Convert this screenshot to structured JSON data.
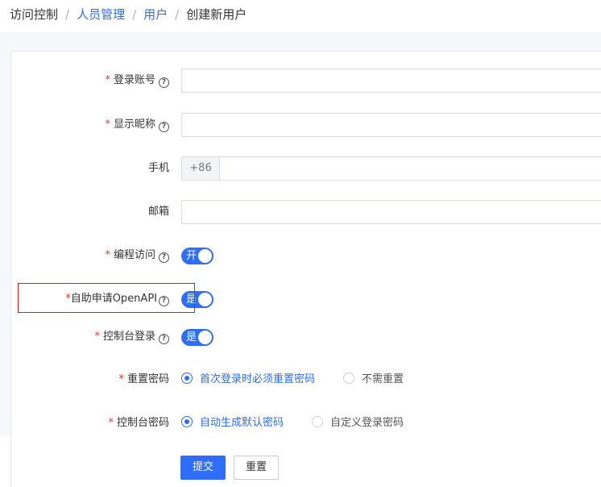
{
  "breadcrumb": {
    "items": [
      "访问控制",
      "人员管理",
      "用户",
      "创建新用户"
    ],
    "separator": "/"
  },
  "form": {
    "login_account": {
      "label": "登录账号",
      "required": "*",
      "value": ""
    },
    "display_name": {
      "label": "显示昵称",
      "required": "*",
      "value": ""
    },
    "phone": {
      "label": "手机",
      "prefix": "+86",
      "value": ""
    },
    "email": {
      "label": "邮箱",
      "value": ""
    },
    "programmatic_access": {
      "label": "编程访问",
      "required": "*",
      "switch_text": "开",
      "on": true
    },
    "self_openapi": {
      "label": "自助申请OpenAPI",
      "required": "*",
      "switch_text": "是",
      "on": true
    },
    "console_login": {
      "label": "控制台登录",
      "required": "*",
      "switch_text": "是",
      "on": true
    },
    "reset_password": {
      "label": "重置密码",
      "required": "*",
      "options": [
        "首次登录时必须重置密码",
        "不需重置"
      ],
      "selected": "首次登录时必须重置密码"
    },
    "console_password": {
      "label": "控制台密码",
      "required": "*",
      "options": [
        "自动生成默认密码",
        "自定义登录密码"
      ],
      "selected": "自动生成默认密码"
    }
  },
  "buttons": {
    "submit": "提交",
    "reset": "重置"
  },
  "help_icon": "?",
  "colors": {
    "primary": "#2f6df6",
    "required": "#e53935",
    "highlight": "#d02020"
  }
}
